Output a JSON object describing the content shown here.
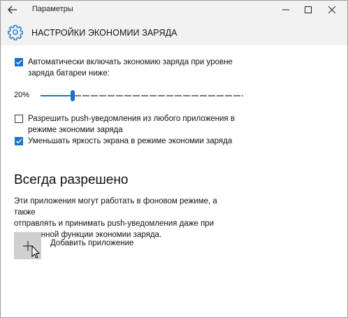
{
  "window": {
    "title": "Параметры",
    "controls": [
      "minimize",
      "maximize",
      "close"
    ]
  },
  "header": {
    "title": "НАСТРОЙКИ ЭКОНОМИИ ЗАРЯДА",
    "icon": "gear-icon"
  },
  "settings": {
    "auto_saver": {
      "checked": true,
      "label_line1": "Автоматически включать экономию заряда при уровне",
      "label_line2": "заряда батареи ниже:"
    },
    "threshold_slider": {
      "value_label": "20%",
      "value": 20
    },
    "allow_push": {
      "checked": false,
      "label_line1": "Разрешить push-уведомления из любого приложения в",
      "label_line2": "режиме экономии заряда"
    },
    "lower_brightness": {
      "checked": true,
      "label": "Уменьшать яркость экрана в режиме экономии заряда"
    }
  },
  "always_allowed": {
    "heading": "Всегда разрешено",
    "description_line1": "Эти приложения могут работать в фоновом режиме, а также",
    "description_line2": "отправлять и принимать push-уведомления даже при",
    "description_line3": "включенной функции экономии заряда.",
    "add_app_label": "Добавить приложение"
  },
  "colors": {
    "accent": "#1a73c7",
    "titlebar_bg": "#f2f2f2",
    "tile_bg": "#cfcfcf"
  }
}
